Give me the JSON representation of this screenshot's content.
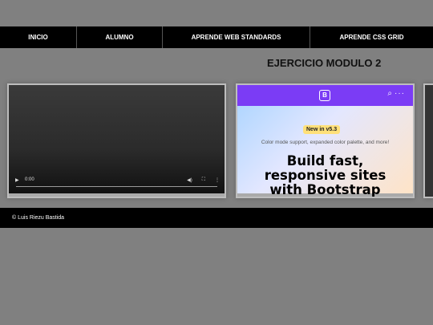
{
  "nav": {
    "items": [
      "INICIO",
      "ALUMNO",
      "APRENDE WEB STANDARDS",
      "APRENDE CSS GRID"
    ]
  },
  "main": {
    "title": "EJERCICIO MODULO 2"
  },
  "video": {
    "time": "0:00"
  },
  "bootstrap_card": {
    "badge": "New in v5.3",
    "subtitle": "Color mode support, expanded color palette, and more!",
    "headline_lines": [
      "Build fast,",
      "responsive sites",
      "with Bootstrap"
    ]
  },
  "footer": {
    "text": "©  Luis Riezu Bastida"
  },
  "colors": {
    "background": "#808080",
    "nav_bg": "#000000",
    "bootstrap_purple": "#7b3cf5",
    "badge_yellow": "#ffe07a"
  }
}
